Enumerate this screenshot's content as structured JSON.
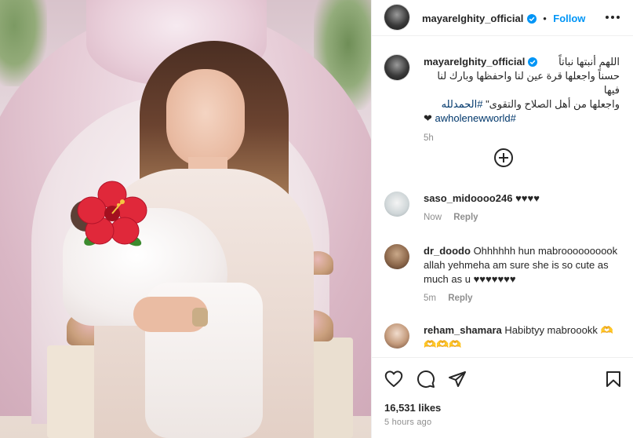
{
  "post": {
    "username": "mayarelghity_official",
    "follow_label": "Follow",
    "dot": "•",
    "caption": {
      "line1": "اللهم أنبتها نباتاً",
      "line2": "حسناً واجعلها قرة عين لنا واحفظها وبارك لنا فيها",
      "line3_text": "واجعلها من أهل الصلاح والتقوى\"",
      "line3_hashtag": "#الحمدلله",
      "line4_heart": "❤",
      "line4_hashtag": "awholenewworld#",
      "time": "5h"
    }
  },
  "comments": [
    {
      "username": "saso_midoooo246",
      "text": "♥♥♥♥",
      "time": "Now",
      "reply_label": "Reply"
    },
    {
      "username": "dr_doodo",
      "text": "Ohhhhhh hun mabroooooooook allah yehmeha am sure she is so cute as much as u ♥♥♥♥♥♥♥",
      "time": "5m",
      "reply_label": "Reply"
    },
    {
      "username": "reham_shamara",
      "text": "Habibtyy mabroookk 🫶",
      "text_line2": "🫶🫶🫶"
    }
  ],
  "footer": {
    "likes": "16,531 likes",
    "posted": "5 hours ago"
  },
  "icons": {
    "more": "more-options-icon",
    "verified": "verified-badge-icon",
    "load_more": "add-circle-icon",
    "like": "heart-icon",
    "comment": "comment-icon",
    "share": "share-icon",
    "save": "bookmark-icon"
  },
  "colors": {
    "link": "#0095f6",
    "hashtag": "#00376b",
    "muted": "#8e8e8e"
  }
}
